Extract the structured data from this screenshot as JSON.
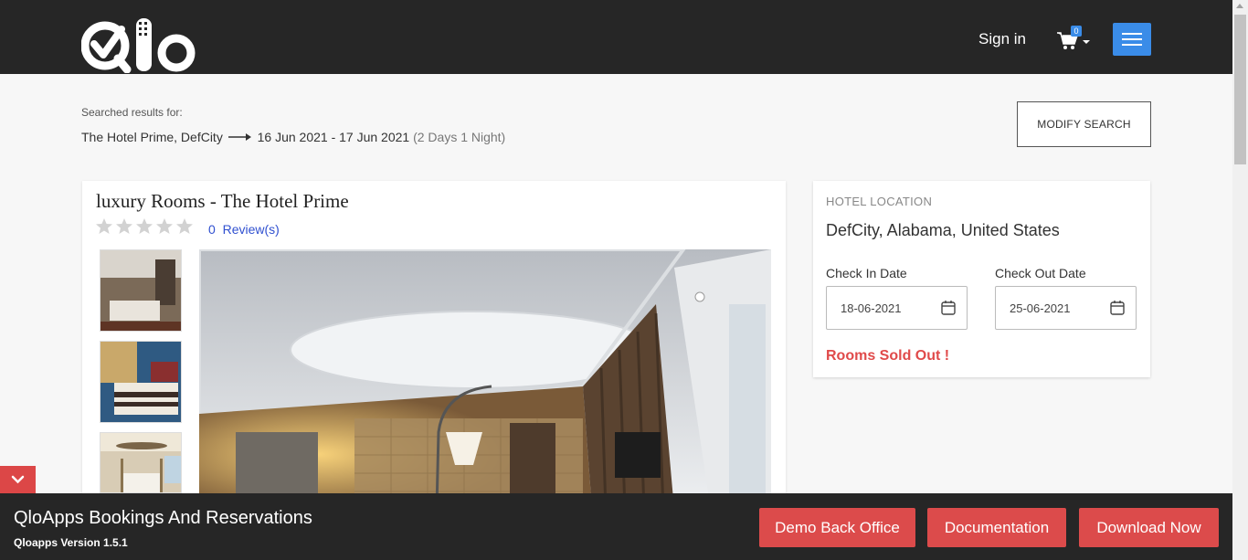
{
  "header": {
    "sign_in": "Sign in",
    "cart_count": "0"
  },
  "search": {
    "label": "Searched results for:",
    "hotel": "The Hotel Prime, DefCity",
    "dates": "16 Jun 2021 - 17 Jun 2021",
    "nights": "(2 Days 1 Night)",
    "modify_label": "MODIFY SEARCH"
  },
  "room": {
    "title": "luxury Rooms - The Hotel Prime",
    "rating": 0,
    "max_rating": 5,
    "review_count": "0",
    "review_label": "Review(s)"
  },
  "location": {
    "label": "HOTEL LOCATION",
    "value": "DefCity, Alabama, United States",
    "check_in_label": "Check In Date",
    "check_in_value": "18-06-2021",
    "check_out_label": "Check Out Date",
    "check_out_value": "25-06-2021",
    "status": "Rooms Sold Out !"
  },
  "footer": {
    "title": "QloApps Bookings And Reservations",
    "version": "Qloapps Version 1.5.1",
    "buttons": [
      "Demo Back Office",
      "Documentation",
      "Download Now"
    ]
  },
  "colors": {
    "header_bg": "#262626",
    "accent_blue": "#3a8ce8",
    "accent_red": "#dc4b4b"
  }
}
